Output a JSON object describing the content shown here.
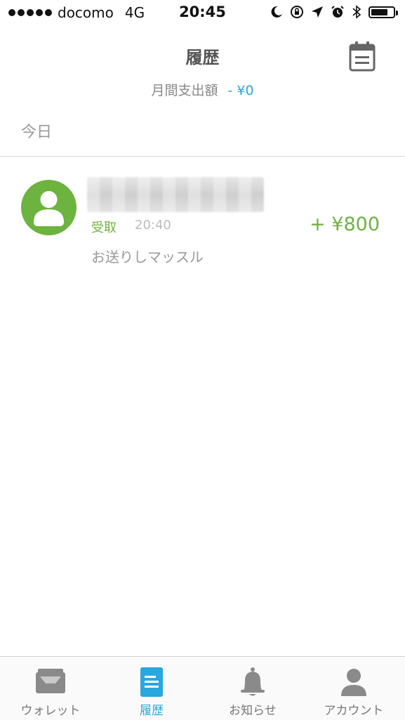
{
  "status_bar": {
    "carrier": "docomo",
    "network": "4G",
    "time": "20:45",
    "battery_level": 0.75,
    "icons": [
      "moon-icon",
      "rotation-lock-icon",
      "location-icon",
      "alarm-icon",
      "bluetooth-icon",
      "battery-icon"
    ]
  },
  "header": {
    "title": "履歴",
    "monthly_label": "月間支出額",
    "monthly_amount": "- ¥0",
    "calendar_icon": "calendar-icon"
  },
  "section": {
    "label": "今日"
  },
  "transactions": [
    {
      "type": "受取",
      "time": "20:40",
      "amount": "+ ¥800",
      "message": "お送りしマッスル",
      "avatar_icon": "user-avatar-icon"
    }
  ],
  "tabbar": {
    "tabs": [
      {
        "label": "ウォレット",
        "icon": "wallet-icon",
        "active": false
      },
      {
        "label": "履歴",
        "icon": "history-icon",
        "active": true
      },
      {
        "label": "お知らせ",
        "icon": "bell-icon",
        "active": false
      },
      {
        "label": "アカウント",
        "icon": "account-icon",
        "active": false
      }
    ]
  },
  "colors": {
    "accent_blue": "#29a7df",
    "receive_green": "#6db33f",
    "muted_text": "#999999"
  }
}
